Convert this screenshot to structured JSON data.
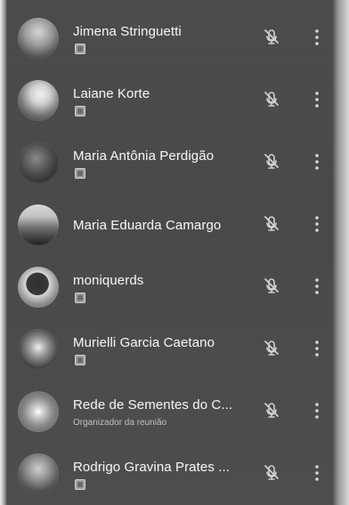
{
  "participants": [
    {
      "name": "Jimena Stringuetti",
      "subtitle": "",
      "avatar_icon": "person-avatar",
      "status_icon": "muted-mic-icon",
      "menu_icon": "more-vertical-icon"
    },
    {
      "name": "Laiane Korte",
      "subtitle": "",
      "avatar_icon": "person-avatar",
      "status_icon": "muted-mic-icon",
      "menu_icon": "more-vertical-icon"
    },
    {
      "name": "Maria Antônia Perdigão",
      "subtitle": "",
      "avatar_icon": "person-avatar",
      "status_icon": "muted-mic-icon",
      "menu_icon": "more-vertical-icon"
    },
    {
      "name": "Maria Eduarda Camargo",
      "subtitle": "",
      "avatar_icon": "person-avatar",
      "status_icon": "muted-mic-icon",
      "menu_icon": "more-vertical-icon"
    },
    {
      "name": "moniquerds",
      "subtitle": "",
      "avatar_icon": "person-avatar",
      "status_icon": "muted-mic-icon",
      "menu_icon": "more-vertical-icon"
    },
    {
      "name": "Murielli Garcia Caetano",
      "subtitle": "",
      "avatar_icon": "person-avatar",
      "status_icon": "muted-mic-icon",
      "menu_icon": "more-vertical-icon"
    },
    {
      "name": "Rede de Sementes do C...",
      "subtitle": "Organizador da reunião",
      "avatar_icon": "organization-avatar",
      "status_icon": "muted-mic-icon",
      "menu_icon": "more-vertical-icon"
    },
    {
      "name": "Rodrigo Gravina Prates ...",
      "subtitle": "",
      "avatar_icon": "person-avatar",
      "status_icon": "muted-mic-icon",
      "menu_icon": "more-vertical-icon"
    }
  ],
  "colors": {
    "background": "#4b4b4b",
    "text": "#f2f2f2",
    "muted_text": "#c8c8c8",
    "icon": "#d0d0d0"
  }
}
